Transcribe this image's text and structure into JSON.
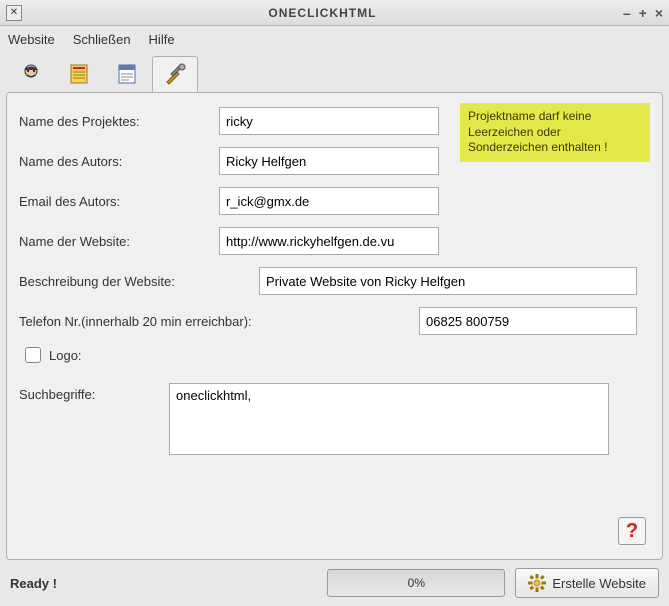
{
  "window": {
    "title": "ONECLICKHTML"
  },
  "menu": {
    "website": "Website",
    "close": "Schließen",
    "help": "Hilfe"
  },
  "warn": "Projektname darf keine Leerzeichen oder Sonderzeichen enthalten !",
  "labels": {
    "project": "Name des Projektes:",
    "author": "Name des Autors:",
    "email": "Email des Autors:",
    "site": "Name der Website:",
    "desc": "Beschreibung der Website:",
    "phone": "Telefon Nr.(innerhalb 20 min erreichbar):",
    "logo": "Logo:",
    "keywords": "Suchbegriffe:"
  },
  "values": {
    "project": "ricky",
    "author": "Ricky Helfgen",
    "email": "r_ick@gmx.de",
    "site": "http://www.rickyhelfgen.de.vu",
    "desc": "Private Website von Ricky Helfgen",
    "phone": "06825 800759",
    "keywords": "oneclickhtml,"
  },
  "status": {
    "ready": "Ready !",
    "progress": "0%",
    "create": "Erstelle Website"
  }
}
